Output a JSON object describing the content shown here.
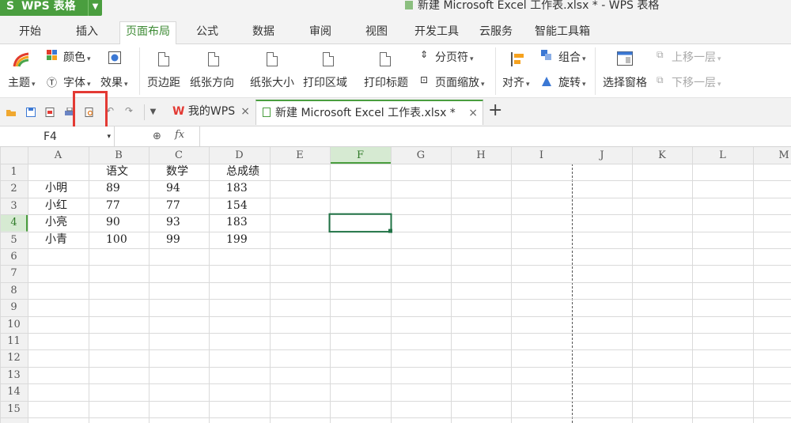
{
  "app": {
    "name": "WPS 表格",
    "doc_title": "新建 Microsoft Excel 工作表.xlsx * - WPS 表格"
  },
  "menu": {
    "tabs": [
      "开始",
      "插入",
      "页面布局",
      "公式",
      "数据",
      "审阅",
      "视图",
      "开发工具",
      "云服务",
      "智能工具箱"
    ],
    "active": "页面布局"
  },
  "ribbon": {
    "theme": "主题",
    "color": "颜色",
    "font": "字体",
    "effect": "效果",
    "margins": "页边距",
    "orientation": "纸张方向",
    "size": "纸张大小",
    "print_area": "打印区域",
    "print_titles": "打印标题",
    "page_break": "分页符",
    "page_scale": "页面缩放",
    "align": "对齐",
    "group": "组合",
    "rotate": "旋转",
    "selection_pane": "选择窗格",
    "bring_forward": "上移一层",
    "send_backward": "下移一层"
  },
  "doc_tabs": {
    "home": "我的WPS",
    "book": "新建 Microsoft Excel 工作表.xlsx *"
  },
  "formula_bar": {
    "name_box": "F4",
    "fx": "fx"
  },
  "sheet": {
    "columns": [
      "A",
      "B",
      "C",
      "D",
      "E",
      "F",
      "G",
      "H",
      "I",
      "J",
      "K",
      "L",
      "M"
    ],
    "rows": [
      "1",
      "2",
      "3",
      "4",
      "5",
      "6",
      "7",
      "8",
      "9",
      "10",
      "11",
      "12",
      "13",
      "14",
      "15"
    ],
    "selected_cell": "F4",
    "cells": {
      "B1": "语文",
      "C1": "数学",
      "D1": "总成绩",
      "A2": "小明",
      "B2": "89",
      "C2": "94",
      "D2": "183",
      "A3": "小红",
      "B3": "77",
      "C3": "77",
      "D3": "154",
      "A4": "小亮",
      "B4": "90",
      "C4": "93",
      "D4": "183",
      "A5": "小青",
      "B5": "100",
      "C5": "99",
      "D5": "199"
    }
  },
  "colors": {
    "accent": "#4a9e3f",
    "highlight": "#e33a34",
    "selection": "#217346"
  }
}
